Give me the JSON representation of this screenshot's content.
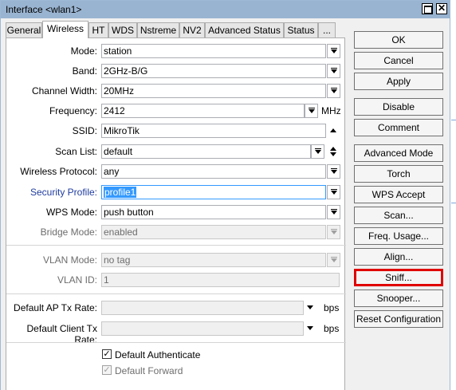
{
  "window": {
    "title": "Interface <wlan1>",
    "close_glyph": "✕"
  },
  "tabs": [
    {
      "label": "General"
    },
    {
      "label": "Wireless"
    },
    {
      "label": "HT"
    },
    {
      "label": "WDS"
    },
    {
      "label": "Nstreme"
    },
    {
      "label": "NV2"
    },
    {
      "label": "Advanced Status"
    },
    {
      "label": "Status"
    },
    {
      "label": "..."
    }
  ],
  "active_tab": "Wireless",
  "form": {
    "mode": {
      "label": "Mode:",
      "value": "station"
    },
    "band": {
      "label": "Band:",
      "value": "2GHz-B/G"
    },
    "channel_width": {
      "label": "Channel Width:",
      "value": "20MHz"
    },
    "frequency": {
      "label": "Frequency:",
      "value": "2412",
      "unit": "MHz"
    },
    "ssid": {
      "label": "SSID:",
      "value": "MikroTik"
    },
    "scan_list": {
      "label": "Scan List:",
      "value": "default"
    },
    "wireless_protocol": {
      "label": "Wireless Protocol:",
      "value": "any"
    },
    "security_profile": {
      "label": "Security Profile:",
      "value": "profile1"
    },
    "wps_mode": {
      "label": "WPS Mode:",
      "value": "push button"
    },
    "bridge_mode": {
      "label": "Bridge Mode:",
      "value": "enabled"
    },
    "vlan_mode": {
      "label": "VLAN Mode:",
      "value": "no tag"
    },
    "vlan_id": {
      "label": "VLAN ID:",
      "value": "1"
    },
    "default_ap_tx_rate": {
      "label": "Default AP Tx Rate:",
      "value": "",
      "unit": "bps"
    },
    "default_client_tx_rate": {
      "label": "Default Client Tx Rate:",
      "value": "",
      "unit": "bps"
    },
    "default_authenticate": {
      "label": "Default Authenticate",
      "checked": true,
      "check_glyph": "✓"
    },
    "default_forward": {
      "label": "Default Forward",
      "checked": true,
      "check_glyph": "✓"
    }
  },
  "buttons": {
    "ok": "OK",
    "cancel": "Cancel",
    "apply": "Apply",
    "disable": "Disable",
    "comment": "Comment",
    "advanced_mode": "Advanced Mode",
    "torch": "Torch",
    "wps_accept": "WPS Accept",
    "scan": "Scan...",
    "freq_usage": "Freq. Usage...",
    "align": "Align...",
    "sniff": "Sniff...",
    "snooper": "Snooper...",
    "reset_configuration": "Reset Configuration"
  },
  "colors": {
    "titlebar": "#99b4d1",
    "highlight_border": "#e00000",
    "selection": "#3399ff",
    "security_label": "#1f3c9e"
  }
}
